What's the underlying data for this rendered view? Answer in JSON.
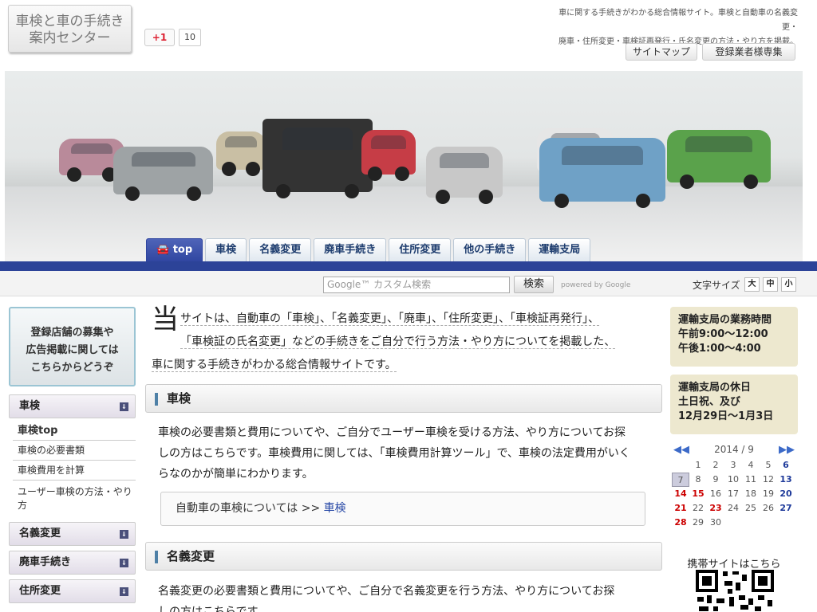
{
  "header": {
    "logo_line1": "車検と車の手続き",
    "logo_line2": "案内センター",
    "gplus_label": "+1",
    "gplus_count": "10",
    "desc_line1": "車に関する手続きがわかる総合情報サイト。車検と自動車の名義変更・",
    "desc_line2": "廃車・住所変更・車検証再発行・氏名変更の方法・やり方を掲載。",
    "sitemap": "サイトマップ",
    "members": "登録業者様専集"
  },
  "tabs": [
    "top",
    "車検",
    "名義変更",
    "廃車手続き",
    "住所変更",
    "他の手続き",
    "運輸支局"
  ],
  "search": {
    "placeholder": "Google™ カスタム検索",
    "button": "検索",
    "powered": "powered by Google",
    "font_size_label": "文字サイズ",
    "large": "大",
    "medium": "中",
    "small": "小"
  },
  "sidebar": {
    "recruit_line1": "登録店舗の募集や",
    "recruit_line2": "広告掲載に関しては",
    "recruit_line3": "こちらからどうぞ",
    "menu_shaken": "車検",
    "sub_top": "車検top",
    "sub_docs": "車検の必要書類",
    "sub_cost": "車検費用を計算",
    "sub_user": "ユーザー車検の方法・やり方",
    "menu_meigi": "名義変更",
    "menu_haisha": "廃車手続き",
    "menu_jusho": "住所変更",
    "arrow": "⇓"
  },
  "main": {
    "intro_big": "当",
    "intro_line1": "サイトは、自動車の「車検」、「名義変更」、「廃車」、「住所変更」、「車検証再発行」、",
    "intro_line2": "「車検証の氏名変更」などの手続きをご自分で行う方法・やり方についてを掲載した、",
    "intro_line3": "車に関する手続きがわかる総合情報サイトです。",
    "sec1_title": "車検",
    "sec1_line1": "車検の必要書類と費用についてや、ご自分でユーザー車検を受ける方法、やり方についてお探",
    "sec1_line2": "しの方はこちらです。車検費用に関しては、「車検費用計算ツール」で、車検の法定費用がいく",
    "sec1_line3": "らなのかが簡単にわかります。",
    "link_prefix": "自動車の車検については >> ",
    "link_text": "車検",
    "sec2_title": "名義変更",
    "sec2_line1": "名義変更の必要書類と費用についてや、ご自分で名義変更を行う方法、やり方についてお探",
    "sec2_line2": "しの方はこちらです。"
  },
  "right": {
    "hours_title": "運輸支局の業務時間",
    "hours_am": "午前9:00～12:00",
    "hours_pm": "午後1:00～4:00",
    "holiday_title": "運輸支局の休日",
    "holiday_line1": "土日祝、及び",
    "holiday_line2": "12月29日～1月3日",
    "cal_title": "2014 / 9",
    "cal_prev": "◀◀",
    "cal_next": "▶▶",
    "calendar": [
      [
        "",
        "1",
        "2",
        "3",
        "4",
        "5",
        "6"
      ],
      [
        "7",
        "8",
        "9",
        "10",
        "11",
        "12",
        "13"
      ],
      [
        "14",
        "15",
        "16",
        "17",
        "18",
        "19",
        "20"
      ],
      [
        "21",
        "22",
        "23",
        "24",
        "25",
        "26",
        "27"
      ],
      [
        "28",
        "29",
        "30",
        "",
        "",
        "",
        ""
      ]
    ],
    "mobile_label": "携帯サイトはこちら"
  },
  "colors": {
    "nav_bar": "#2c4398",
    "info_box": "#ede8cf",
    "link": "#2748a6",
    "holiday": "#cc0000",
    "saturday": "#1e3a9a"
  }
}
